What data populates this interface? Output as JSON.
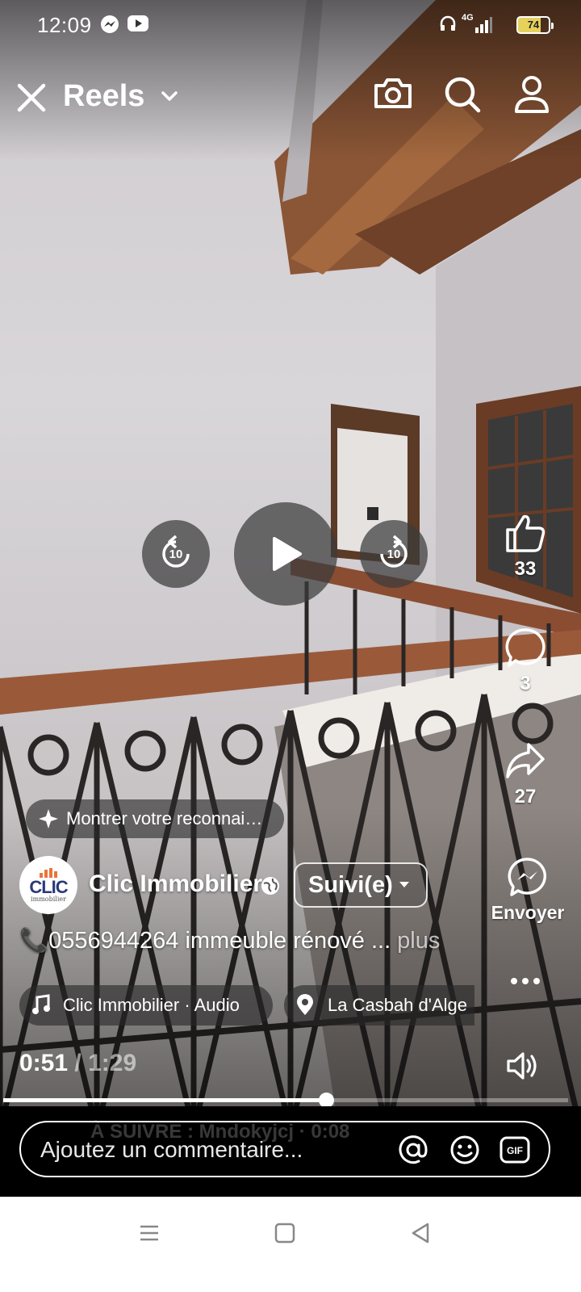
{
  "status_bar": {
    "time": "12:09",
    "network": "4G",
    "battery": "74"
  },
  "header": {
    "title": "Reels"
  },
  "controls": {
    "rewind_label": "10",
    "forward_label": "10"
  },
  "rail": {
    "likes": "33",
    "comments": "3",
    "shares": "27",
    "send_label": "Envoyer"
  },
  "post": {
    "appreciation_label": "Montrer votre reconnai…",
    "page_name": "Clic Immobilier",
    "follow_label": "Suivi(e)",
    "caption": "📞0556944264 immeuble rénové ...",
    "caption_more": " plus",
    "audio_label": "Clic Immobilier · Audio",
    "location_label": "La Casbah d'Alge",
    "avatar_text": "CLIC",
    "avatar_sub": "immobilier"
  },
  "playback": {
    "current_time": "0:51",
    "separator": "/",
    "duration": "1:29",
    "progress_fraction": 0.573
  },
  "up_next": {
    "text": "À SUIVRE : Mndokyjcj · 0:08"
  },
  "comment": {
    "placeholder": "Ajoutez un commentaire..."
  },
  "icons": {
    "close": "close-icon",
    "camera": "camera-icon",
    "search": "search-icon",
    "profile": "profile-icon",
    "like": "thumbs-up-icon",
    "comment": "comment-bubble-icon",
    "share": "share-arrow-icon",
    "messenger": "messenger-icon",
    "more": "more-dots-icon",
    "volume": "volume-icon",
    "audio": "music-note-icon",
    "location": "location-pin-icon",
    "mention": "at-icon",
    "emoji": "emoji-icon",
    "gif": "gif-icon"
  },
  "colors": {
    "battery": "#e5d15b",
    "avatar_brand": "#2a3a7a",
    "avatar_bars": "#e8763a"
  }
}
